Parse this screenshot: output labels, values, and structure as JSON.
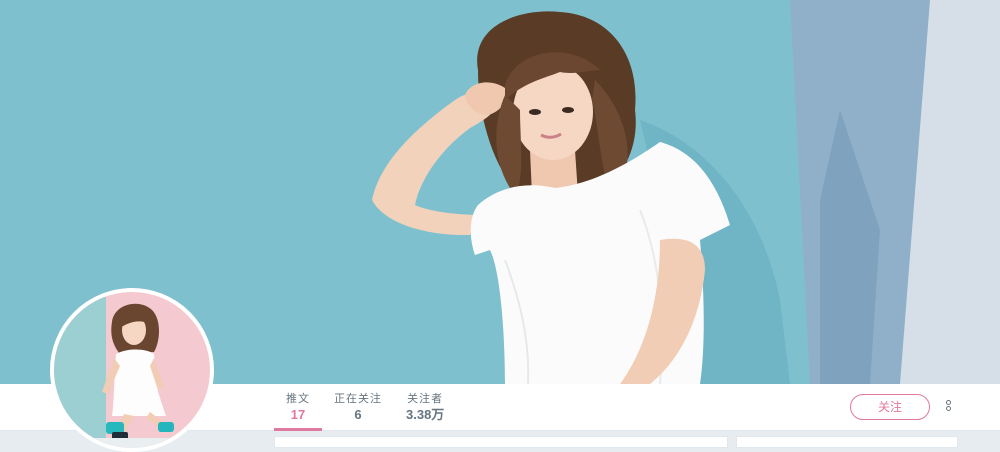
{
  "profile_nav": {
    "stats": [
      {
        "label": "推文",
        "value": "17",
        "active": true
      },
      {
        "label": "正在关注",
        "value": "6",
        "active": false
      },
      {
        "label": "关注者",
        "value": "3.38万",
        "active": false
      }
    ],
    "follow_label": "关注",
    "more_icon": "more-vertical-icon"
  },
  "colors": {
    "accent": "#e0799f",
    "banner_bg": "#7fc0cf",
    "avatar_bg_pink": "#f4c9d0",
    "avatar_bg_teal": "#9ccfd2",
    "page_bg": "#e6ecf0"
  }
}
